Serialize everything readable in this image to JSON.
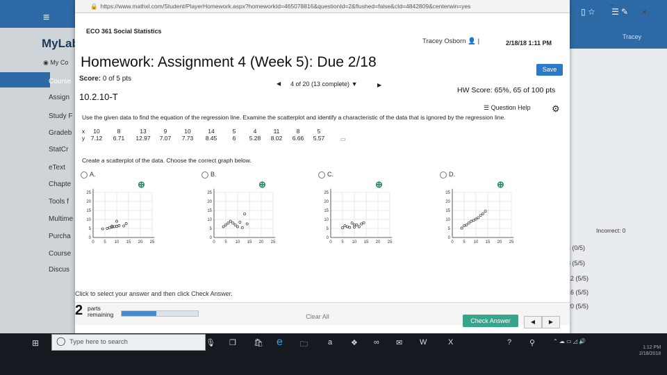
{
  "browser": {
    "url": "https://www.mathxl.com/Student/PlayerHomework.aspx?homeworkId=465078816&questionId=2&flushed=false&cId=4842809&centerwin=yes"
  },
  "background_app": {
    "brand": "MyLab",
    "my_courses": "My Co",
    "sidebar": [
      "Course",
      "Assign",
      "Study F",
      "Gradeb",
      "StatCr",
      "eText",
      "Chapte",
      "Tools f",
      "Multime",
      "Purcha",
      "Course",
      "Discus"
    ],
    "user": "Tracey",
    "incorrect_label": "Incorrect: 0",
    "scores": [
      "4 (0/5)",
      "8 (5/5)",
      "12 (5/5)",
      "16 (5/5)",
      "20 (5/5)"
    ]
  },
  "header": {
    "course": "ECO 361 Social Statistics",
    "student": "Tracey Osborn",
    "datetime": "2/18/18 1:11 PM"
  },
  "homework": {
    "title": "Homework: Assignment 4 (Week 5): Due 2/18",
    "save_label": "Save",
    "score_label": "Score:",
    "score_value": "0 of 5 pts",
    "progress": "4 of 20 (13 complete)",
    "hw_score": "HW Score: 65%, 65 of 100 pts",
    "question_id": "10.2.10-T",
    "question_help": "Question Help"
  },
  "question": {
    "instruction": "Use the given data to find the equation of the regression line. Examine the scatterplot and identify a characteristic of the data that is ignored by the regression line.",
    "x_label": "x",
    "y_label": "y",
    "x_values": [
      "10",
      "8",
      "13",
      "9",
      "10",
      "14",
      "5",
      "4",
      "11",
      "8",
      "5"
    ],
    "y_values": [
      "7.12",
      "6.71",
      "12.97",
      "7.07",
      "7.73",
      "8.45",
      "6",
      "5.28",
      "8.02",
      "6.66",
      "5.57"
    ],
    "prompt": "Create a scatterplot of the data. Choose the correct graph below.",
    "options": [
      {
        "label": "A."
      },
      {
        "label": "B."
      },
      {
        "label": "C."
      },
      {
        "label": "D."
      }
    ],
    "axis_x_ticks": [
      "0",
      "5",
      "10",
      "15",
      "20",
      "25"
    ],
    "axis_y_ticks": [
      "0",
      "5",
      "10",
      "15",
      "20",
      "25"
    ],
    "click_instruction": "Click to select your answer and then click Check Answer."
  },
  "footer": {
    "parts_number": "2",
    "parts_word": "parts",
    "remaining_word": "remaining",
    "progress_fraction": 0.45,
    "clear_all": "Clear All",
    "check_answer": "Check Answer"
  },
  "taskbar": {
    "search_placeholder": "Type here to search",
    "time": "1:12 PM",
    "date": "2/18/2018"
  },
  "colors": {
    "accent": "#2c79c9",
    "check": "#35a58b"
  }
}
